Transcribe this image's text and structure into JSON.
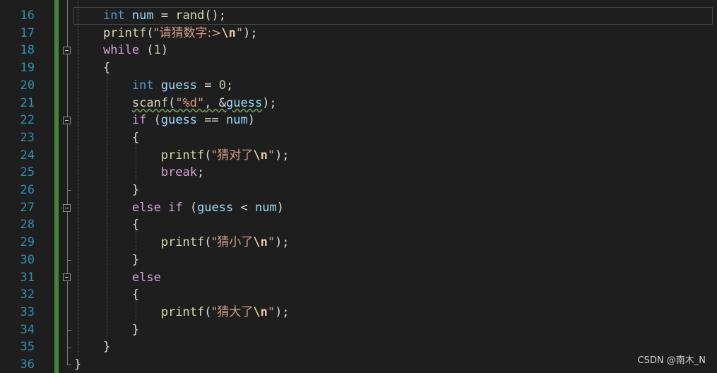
{
  "editor": {
    "line_numbers": [
      "16",
      "17",
      "18",
      "19",
      "20",
      "21",
      "22",
      "23",
      "24",
      "25",
      "26",
      "27",
      "28",
      "29",
      "30",
      "31",
      "32",
      "33",
      "34",
      "35",
      "36"
    ],
    "lines": [
      {
        "tokens": [
          {
            "t": "    ",
            "c": "op"
          },
          {
            "t": "int",
            "c": "kw"
          },
          {
            "t": " ",
            "c": "op"
          },
          {
            "t": "num",
            "c": "var"
          },
          {
            "t": " = ",
            "c": "op"
          },
          {
            "t": "rand",
            "c": "fn"
          },
          {
            "t": "();",
            "c": "op"
          }
        ]
      },
      {
        "tokens": [
          {
            "t": "    ",
            "c": "op"
          },
          {
            "t": "printf",
            "c": "fn"
          },
          {
            "t": "(",
            "c": "op"
          },
          {
            "t": "\"请猜数字:>",
            "c": "str"
          },
          {
            "t": "\\n",
            "c": "esc"
          },
          {
            "t": "\"",
            "c": "str"
          },
          {
            "t": ");",
            "c": "op"
          }
        ]
      },
      {
        "tokens": [
          {
            "t": "    ",
            "c": "op"
          },
          {
            "t": "while",
            "c": "ctl"
          },
          {
            "t": " (",
            "c": "op"
          },
          {
            "t": "1",
            "c": "num"
          },
          {
            "t": ")",
            "c": "op"
          }
        ]
      },
      {
        "tokens": [
          {
            "t": "    {",
            "c": "op"
          }
        ]
      },
      {
        "tokens": [
          {
            "t": "        ",
            "c": "op"
          },
          {
            "t": "int",
            "c": "kw"
          },
          {
            "t": " ",
            "c": "op"
          },
          {
            "t": "guess",
            "c": "var"
          },
          {
            "t": " = ",
            "c": "op"
          },
          {
            "t": "0",
            "c": "num"
          },
          {
            "t": ";",
            "c": "op"
          }
        ]
      },
      {
        "tokens": [
          {
            "t": "        ",
            "c": "op"
          },
          {
            "t": "scanf",
            "c": "fn sq"
          },
          {
            "t": "(",
            "c": "op sq"
          },
          {
            "t": "\"%d\"",
            "c": "str sq"
          },
          {
            "t": ", &",
            "c": "op sq"
          },
          {
            "t": "guess",
            "c": "var sq"
          },
          {
            "t": ");",
            "c": "op"
          }
        ]
      },
      {
        "tokens": [
          {
            "t": "        ",
            "c": "op"
          },
          {
            "t": "if",
            "c": "ctl"
          },
          {
            "t": " (",
            "c": "op"
          },
          {
            "t": "guess",
            "c": "var"
          },
          {
            "t": " == ",
            "c": "op"
          },
          {
            "t": "num",
            "c": "var"
          },
          {
            "t": ")",
            "c": "op"
          }
        ]
      },
      {
        "tokens": [
          {
            "t": "        {",
            "c": "op"
          }
        ]
      },
      {
        "tokens": [
          {
            "t": "            ",
            "c": "op"
          },
          {
            "t": "printf",
            "c": "fn"
          },
          {
            "t": "(",
            "c": "op"
          },
          {
            "t": "\"猜对了",
            "c": "str"
          },
          {
            "t": "\\n",
            "c": "esc"
          },
          {
            "t": "\"",
            "c": "str"
          },
          {
            "t": ");",
            "c": "op"
          }
        ]
      },
      {
        "tokens": [
          {
            "t": "            ",
            "c": "op"
          },
          {
            "t": "break",
            "c": "ctl"
          },
          {
            "t": ";",
            "c": "op"
          }
        ]
      },
      {
        "tokens": [
          {
            "t": "        }",
            "c": "op"
          }
        ]
      },
      {
        "tokens": [
          {
            "t": "        ",
            "c": "op"
          },
          {
            "t": "else",
            "c": "ctl"
          },
          {
            "t": " ",
            "c": "op"
          },
          {
            "t": "if",
            "c": "ctl"
          },
          {
            "t": " (",
            "c": "op"
          },
          {
            "t": "guess",
            "c": "var"
          },
          {
            "t": " < ",
            "c": "op"
          },
          {
            "t": "num",
            "c": "var"
          },
          {
            "t": ")",
            "c": "op"
          }
        ]
      },
      {
        "tokens": [
          {
            "t": "        {",
            "c": "op"
          }
        ]
      },
      {
        "tokens": [
          {
            "t": "            ",
            "c": "op"
          },
          {
            "t": "printf",
            "c": "fn"
          },
          {
            "t": "(",
            "c": "op"
          },
          {
            "t": "\"猜小了",
            "c": "str"
          },
          {
            "t": "\\n",
            "c": "esc"
          },
          {
            "t": "\"",
            "c": "str"
          },
          {
            "t": ");",
            "c": "op"
          }
        ]
      },
      {
        "tokens": [
          {
            "t": "        }",
            "c": "op"
          }
        ]
      },
      {
        "tokens": [
          {
            "t": "        ",
            "c": "op"
          },
          {
            "t": "else",
            "c": "ctl"
          }
        ]
      },
      {
        "tokens": [
          {
            "t": "        {",
            "c": "op"
          }
        ]
      },
      {
        "tokens": [
          {
            "t": "            ",
            "c": "op"
          },
          {
            "t": "printf",
            "c": "fn"
          },
          {
            "t": "(",
            "c": "op"
          },
          {
            "t": "\"猜大了",
            "c": "str"
          },
          {
            "t": "\\n",
            "c": "esc"
          },
          {
            "t": "\"",
            "c": "str"
          },
          {
            "t": ");",
            "c": "op"
          }
        ]
      },
      {
        "tokens": [
          {
            "t": "        }",
            "c": "op"
          }
        ]
      },
      {
        "tokens": [
          {
            "t": "    }",
            "c": "op"
          }
        ]
      },
      {
        "tokens": [
          {
            "t": "}",
            "c": "op"
          }
        ]
      }
    ],
    "fold_lines": [
      "18",
      "22",
      "27",
      "31"
    ]
  },
  "watermark": "CSDN @南木_N",
  "colors": {
    "background": "#1e1e1e",
    "line_number": "#2b91af",
    "keyword": "#569cd6",
    "control": "#d8a0df",
    "function": "#dcdcaa",
    "variable": "#9cdcfe",
    "string": "#d69d85",
    "number": "#b5cea8",
    "change_bar": "#57a64a"
  }
}
